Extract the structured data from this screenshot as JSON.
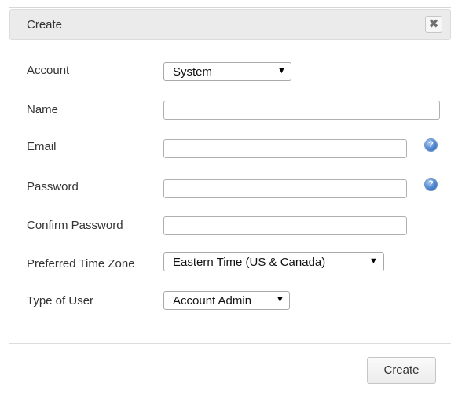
{
  "dialog": {
    "title": "Create",
    "close_symbol": "✖"
  },
  "form": {
    "account": {
      "label": "Account",
      "value": "System"
    },
    "name": {
      "label": "Name",
      "value": "",
      "placeholder": ""
    },
    "email": {
      "label": "Email",
      "value": "",
      "placeholder": ""
    },
    "password": {
      "label": "Password",
      "value": "",
      "placeholder": ""
    },
    "confirm_password": {
      "label": "Confirm Password",
      "value": "",
      "placeholder": ""
    },
    "time_zone": {
      "label": "Preferred Time Zone",
      "value": "Eastern Time (US & Canada)"
    },
    "user_type": {
      "label": "Type of User",
      "value": "Account Admin"
    }
  },
  "icons": {
    "close": "close-icon",
    "help": "help-icon",
    "dropdown": "dropdown-arrow-icon",
    "help_symbol": "?",
    "arrow_symbol": "▼"
  },
  "footer": {
    "create_label": "Create"
  }
}
